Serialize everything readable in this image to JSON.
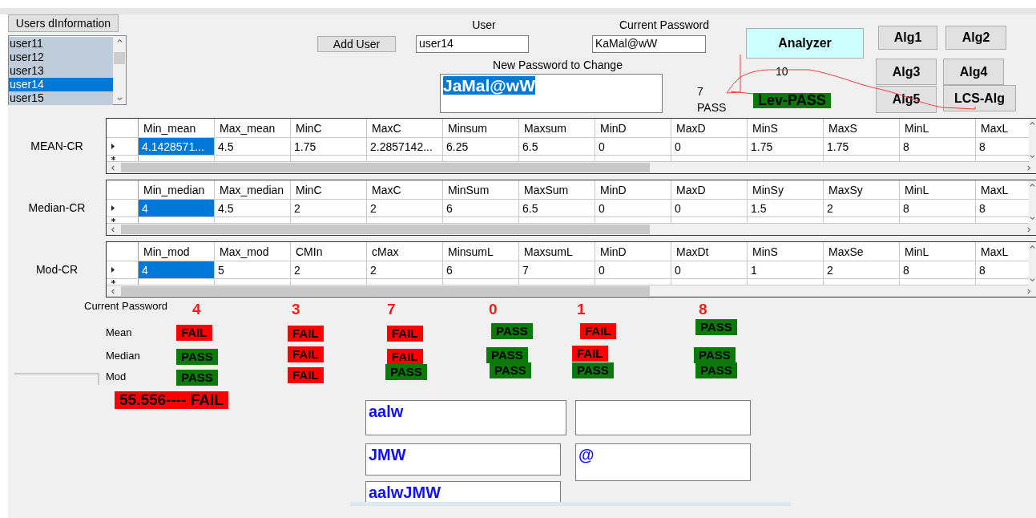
{
  "users_button": "Users dInformation",
  "users_list": {
    "items": [
      {
        "label": "user11",
        "selected": false
      },
      {
        "label": "user12",
        "selected": false
      },
      {
        "label": "user13",
        "selected": false
      },
      {
        "label": "user14",
        "selected": true
      },
      {
        "label": "user15",
        "selected": false
      }
    ]
  },
  "add_user_button": "Add User",
  "user_field": {
    "label": "User",
    "value": "user14"
  },
  "current_password_field": {
    "label": "Current Password",
    "value": "KaMal@wW"
  },
  "new_password_field": {
    "label": "New Password to Change",
    "value": "JaMal@wW",
    "selected": true
  },
  "score": "7",
  "score_result": "PASS",
  "analyzer_button": "Analyzer",
  "distance": "10",
  "lev_result": {
    "text": "Lev-PASS",
    "kind": "pass"
  },
  "algorithm_buttons": [
    "Alg1",
    "Alg2",
    "Alg3",
    "Alg4",
    "Alg5",
    "LCS-Alg"
  ],
  "grids": [
    {
      "label": "MEAN-CR",
      "columns": [
        "Min_mean",
        "Max_mean",
        "MinC",
        "MaxC",
        "Minsum",
        "Maxsum",
        "MinD",
        "MaxD",
        "MinS",
        "MaxS",
        "MinL",
        "MaxL"
      ],
      "cells": [
        {
          "text": "4.1428571...",
          "selected": true
        },
        {
          "text": "4.5",
          "selected": false
        },
        {
          "text": "1.75",
          "selected": false
        },
        {
          "text": "2.2857142...",
          "selected": false
        },
        {
          "text": "6.25",
          "selected": false
        },
        {
          "text": "6.5",
          "selected": false
        },
        {
          "text": "0",
          "selected": false
        },
        {
          "text": "0",
          "selected": false
        },
        {
          "text": "1.75",
          "selected": false
        },
        {
          "text": "1.75",
          "selected": false
        },
        {
          "text": "8",
          "selected": false
        },
        {
          "text": "8",
          "selected": false
        }
      ]
    },
    {
      "label": "Median-CR",
      "columns": [
        "Min_median",
        "Max_median",
        "MinC",
        "MaxC",
        "MinSum",
        "MaxSum",
        "MinD",
        "MaxD",
        "MinSy",
        "MaxSy",
        "MinL",
        "MaxL"
      ],
      "cells": [
        {
          "text": "4",
          "selected": true
        },
        {
          "text": "4.5",
          "selected": false
        },
        {
          "text": "2",
          "selected": false
        },
        {
          "text": "2",
          "selected": false
        },
        {
          "text": "6",
          "selected": false
        },
        {
          "text": "6.5",
          "selected": false
        },
        {
          "text": "0",
          "selected": false
        },
        {
          "text": "0",
          "selected": false
        },
        {
          "text": "1.5",
          "selected": false
        },
        {
          "text": "2",
          "selected": false
        },
        {
          "text": "8",
          "selected": false
        },
        {
          "text": "8",
          "selected": false
        }
      ]
    },
    {
      "label": "Mod-CR",
      "columns": [
        "Min_mod",
        "Max_mod",
        "CMIn",
        "cMax",
        "MinsumL",
        "MaxsumL",
        "MinD",
        "MaxDt",
        "MinS",
        "MaxSe",
        "MinL",
        "MaxL"
      ],
      "cells": [
        {
          "text": "4",
          "selected": true
        },
        {
          "text": "5",
          "selected": false
        },
        {
          "text": "2",
          "selected": false
        },
        {
          "text": "2",
          "selected": false
        },
        {
          "text": "6",
          "selected": false
        },
        {
          "text": "7",
          "selected": false
        },
        {
          "text": "0",
          "selected": false
        },
        {
          "text": "0",
          "selected": false
        },
        {
          "text": "1",
          "selected": false
        },
        {
          "text": "2",
          "selected": false
        },
        {
          "text": "8",
          "selected": false
        },
        {
          "text": "8",
          "selected": false
        }
      ]
    }
  ],
  "results": {
    "label": "Current Password",
    "row_labels": [
      "Mean",
      "Median",
      "Mod"
    ],
    "columns": [
      {
        "digit": "4",
        "badges": [
          {
            "text": "FAIL",
            "kind": "fail"
          },
          {
            "text": "PASS",
            "kind": "pass"
          },
          {
            "text": "PASS",
            "kind": "pass"
          }
        ]
      },
      {
        "digit": "3",
        "badges": [
          {
            "text": "FAIL",
            "kind": "fail"
          },
          {
            "text": "FAIL",
            "kind": "fail"
          },
          {
            "text": "FAIL",
            "kind": "fail"
          }
        ]
      },
      {
        "digit": "7",
        "badges": [
          {
            "text": "FAIL",
            "kind": "fail"
          },
          {
            "text": "FAIL",
            "kind": "fail"
          },
          {
            "text": "PASS",
            "kind": "pass"
          }
        ]
      },
      {
        "digit": "0",
        "badges": [
          {
            "text": "PASS",
            "kind": "pass"
          },
          {
            "text": "PASS",
            "kind": "pass"
          },
          {
            "text": "PASS",
            "kind": "pass"
          }
        ]
      },
      {
        "digit": "1",
        "badges": [
          {
            "text": "FAIL",
            "kind": "fail"
          },
          {
            "text": "FAIL",
            "kind": "fail"
          },
          {
            "text": "PASS",
            "kind": "pass"
          }
        ]
      },
      {
        "digit": "8",
        "badges": [
          {
            "text": "PASS",
            "kind": "pass"
          },
          {
            "text": "PASS",
            "kind": "pass"
          },
          {
            "text": "PASS",
            "kind": "pass"
          }
        ]
      }
    ]
  },
  "summary": {
    "text": "55.556---- FAIL",
    "kind": "fail"
  },
  "output_fields": {
    "left": [
      {
        "value": "aalw"
      },
      {
        "value": "JMW"
      },
      {
        "value": "aalwJMW"
      }
    ],
    "right": [
      {
        "kind": "blank"
      },
      {
        "kind": "text",
        "value": "@"
      }
    ]
  }
}
